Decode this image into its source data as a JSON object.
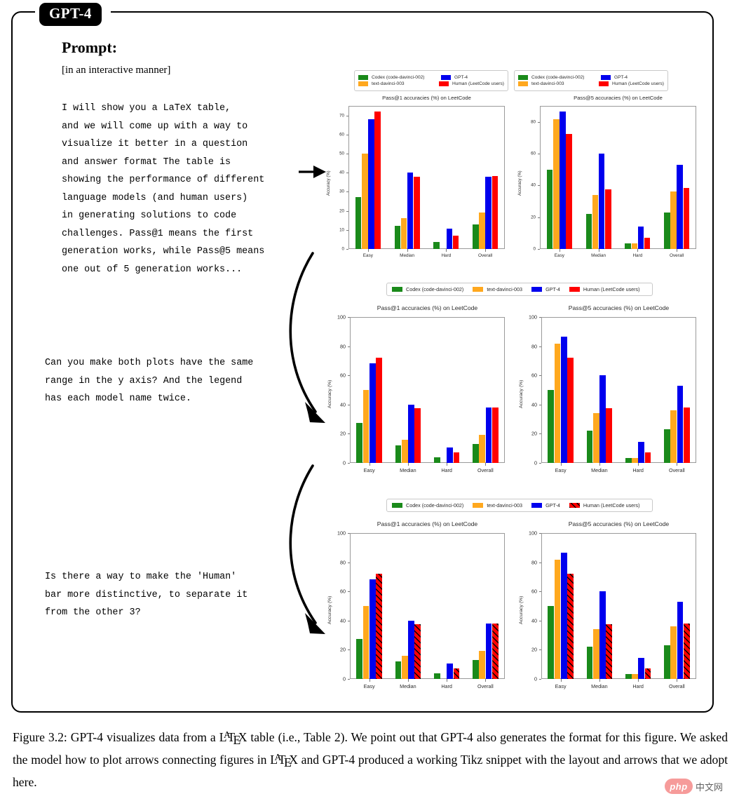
{
  "window": {
    "tag_label": "GPT-4"
  },
  "prompt": {
    "heading": "Prompt:",
    "subheading": "[in an interactive manner]",
    "turn1": "I will show you a LaTeX table,\nand we will come up with a way to\nvisualize it better in a question\nand answer format The table is\nshowing the performance of different\nlanguage models (and human users)\nin generating solutions to code\nchallenges. Pass@1 means the first\ngeneration works, while Pass@5 means\none out of 5 generation works...",
    "turn2": "Can you make both plots have the same\nrange in the y axis? And the legend\nhas each model name twice.",
    "turn3": "Is there a way to make the 'Human'\nbar more distinctive, to separate it\nfrom the other 3?"
  },
  "colors": {
    "codex": "#1a8a1a",
    "text_davinci": "#FFA81E",
    "gpt4": "#0000EE",
    "human": "#FF0000",
    "hatch": "#000000",
    "axis": "#9a9a9a",
    "text": "#2b2b2b"
  },
  "series_names": {
    "codex": "Codex (code-davinci-002)",
    "text_davinci": "text-davinci-003",
    "gpt4": "GPT-4",
    "human": "Human (LeetCode users)"
  },
  "chart_data": [
    {
      "id": "row1-pass1",
      "type": "bar",
      "title": "Pass@1 accuracies (%) on LeetCode",
      "xlabel": "",
      "ylabel": "Accuracy (%)",
      "categories": [
        "Easy",
        "Median",
        "Hard",
        "Overall"
      ],
      "ylim": [
        0,
        75
      ],
      "yticks": [
        0,
        10,
        20,
        30,
        40,
        50,
        60,
        70
      ],
      "grid": false,
      "legend_position": "above-left",
      "legend_duplicated": true,
      "series": [
        {
          "name": "Codex (code-davinci-002)",
          "color": "#1a8a1a",
          "values": [
            27.3,
            12.0,
            3.7,
            13.0
          ]
        },
        {
          "name": "text-davinci-003",
          "color": "#FFA81E",
          "values": [
            50.0,
            16.0,
            0.0,
            19.0
          ]
        },
        {
          "name": "GPT-4",
          "color": "#0000EE",
          "values": [
            68.2,
            40.0,
            10.7,
            38.0
          ]
        },
        {
          "name": "Human (LeetCode users)",
          "color": "#FF0000",
          "values": [
            72.2,
            37.7,
            7.0,
            38.2
          ]
        }
      ]
    },
    {
      "id": "row1-pass5",
      "type": "bar",
      "title": "Pass@5 accuracies (%) on LeetCode",
      "xlabel": "",
      "ylabel": "Accuracy (%)",
      "categories": [
        "Easy",
        "Median",
        "Hard",
        "Overall"
      ],
      "ylim": [
        0,
        90
      ],
      "yticks": [
        0,
        20,
        40,
        60,
        80
      ],
      "grid": false,
      "legend_position": "above-right",
      "legend_duplicated": true,
      "series": [
        {
          "name": "Codex (code-davinci-002)",
          "color": "#1a8a1a",
          "values": [
            49.8,
            22.0,
            3.6,
            23.0
          ]
        },
        {
          "name": "text-davinci-003",
          "color": "#FFA81E",
          "values": [
            81.8,
            34.0,
            3.6,
            36.0
          ]
        },
        {
          "name": "GPT-4",
          "color": "#0000EE",
          "values": [
            86.4,
            60.0,
            14.3,
            53.0
          ]
        },
        {
          "name": "Human (LeetCode users)",
          "color": "#FF0000",
          "values": [
            72.2,
            37.7,
            7.0,
            38.2
          ]
        }
      ]
    },
    {
      "id": "row2-pass1",
      "type": "bar",
      "title": "Pass@1 accuracies (%) on LeetCode",
      "xlabel": "",
      "ylabel": "Accuracy (%)",
      "categories": [
        "Easy",
        "Median",
        "Hard",
        "Overall"
      ],
      "ylim": [
        0,
        100
      ],
      "yticks": [
        0,
        20,
        40,
        60,
        80,
        100
      ],
      "grid": false,
      "legend_position": "above-center-shared",
      "legend_duplicated": false,
      "series": [
        {
          "name": "Codex (code-davinci-002)",
          "color": "#1a8a1a",
          "values": [
            27.3,
            12.0,
            3.7,
            13.0
          ]
        },
        {
          "name": "text-davinci-003",
          "color": "#FFA81E",
          "values": [
            50.0,
            16.0,
            0.0,
            19.0
          ]
        },
        {
          "name": "GPT-4",
          "color": "#0000EE",
          "values": [
            68.2,
            40.0,
            10.7,
            38.0
          ]
        },
        {
          "name": "Human (LeetCode users)",
          "color": "#FF0000",
          "values": [
            72.2,
            37.7,
            7.0,
            38.2
          ]
        }
      ]
    },
    {
      "id": "row2-pass5",
      "type": "bar",
      "title": "Pass@5 accuracies (%) on LeetCode",
      "xlabel": "",
      "ylabel": "Accuracy (%)",
      "categories": [
        "Easy",
        "Median",
        "Hard",
        "Overall"
      ],
      "ylim": [
        0,
        100
      ],
      "yticks": [
        0,
        20,
        40,
        60,
        80,
        100
      ],
      "grid": false,
      "legend_position": "above-center-shared",
      "legend_duplicated": false,
      "series": [
        {
          "name": "Codex (code-davinci-002)",
          "color": "#1a8a1a",
          "values": [
            49.8,
            22.0,
            3.6,
            23.0
          ]
        },
        {
          "name": "text-davinci-003",
          "color": "#FFA81E",
          "values": [
            81.8,
            34.0,
            3.6,
            36.0
          ]
        },
        {
          "name": "GPT-4",
          "color": "#0000EE",
          "values": [
            86.4,
            60.0,
            14.3,
            53.0
          ]
        },
        {
          "name": "Human (LeetCode users)",
          "color": "#FF0000",
          "values": [
            72.2,
            37.7,
            7.0,
            38.2
          ]
        }
      ]
    },
    {
      "id": "row3-pass1",
      "type": "bar",
      "title": "Pass@1 accuracies (%) on LeetCode",
      "xlabel": "",
      "ylabel": "Accuracy (%)",
      "categories": [
        "Easy",
        "Median",
        "Hard",
        "Overall"
      ],
      "ylim": [
        0,
        100
      ],
      "yticks": [
        0,
        20,
        40,
        60,
        80,
        100
      ],
      "grid": false,
      "legend_position": "above-center-shared",
      "legend_duplicated": false,
      "human_hatched": true,
      "series": [
        {
          "name": "Codex (code-davinci-002)",
          "color": "#1a8a1a",
          "values": [
            27.3,
            12.0,
            3.7,
            13.0
          ]
        },
        {
          "name": "text-davinci-003",
          "color": "#FFA81E",
          "values": [
            50.0,
            16.0,
            0.0,
            19.0
          ]
        },
        {
          "name": "GPT-4",
          "color": "#0000EE",
          "values": [
            68.2,
            40.0,
            10.7,
            38.0
          ]
        },
        {
          "name": "Human (LeetCode users)",
          "color": "#FF0000",
          "values": [
            72.2,
            37.7,
            7.0,
            38.2
          ]
        }
      ]
    },
    {
      "id": "row3-pass5",
      "type": "bar",
      "title": "Pass@5 accuracies (%) on LeetCode",
      "xlabel": "",
      "ylabel": "Accuracy (%)",
      "categories": [
        "Easy",
        "Median",
        "Hard",
        "Overall"
      ],
      "ylim": [
        0,
        100
      ],
      "yticks": [
        0,
        20,
        40,
        60,
        80,
        100
      ],
      "grid": false,
      "legend_position": "above-center-shared",
      "legend_duplicated": false,
      "human_hatched": true,
      "series": [
        {
          "name": "Codex (code-davinci-002)",
          "color": "#1a8a1a",
          "values": [
            49.8,
            22.0,
            3.6,
            23.0
          ]
        },
        {
          "name": "text-davinci-003",
          "color": "#FFA81E",
          "values": [
            81.8,
            34.0,
            3.6,
            36.0
          ]
        },
        {
          "name": "GPT-4",
          "color": "#0000EE",
          "values": [
            86.4,
            60.0,
            14.3,
            53.0
          ]
        },
        {
          "name": "Human (LeetCode users)",
          "color": "#FF0000",
          "values": [
            72.2,
            37.7,
            7.0,
            38.2
          ]
        }
      ]
    }
  ],
  "caption": {
    "figure_number": "Figure 3.2:",
    "line_a": " GPT-4 visualizes data from a ",
    "line_b": " table (i.e., Table 2). We point out that GPT-4 also generates the format for this figure. We asked the model how to plot arrows connecting figures in ",
    "line_c": " and GPT-4 produced a working Tikz snippet with the layout and arrows that we adopt here."
  },
  "watermark": {
    "badge": "php",
    "text": "中文网"
  }
}
